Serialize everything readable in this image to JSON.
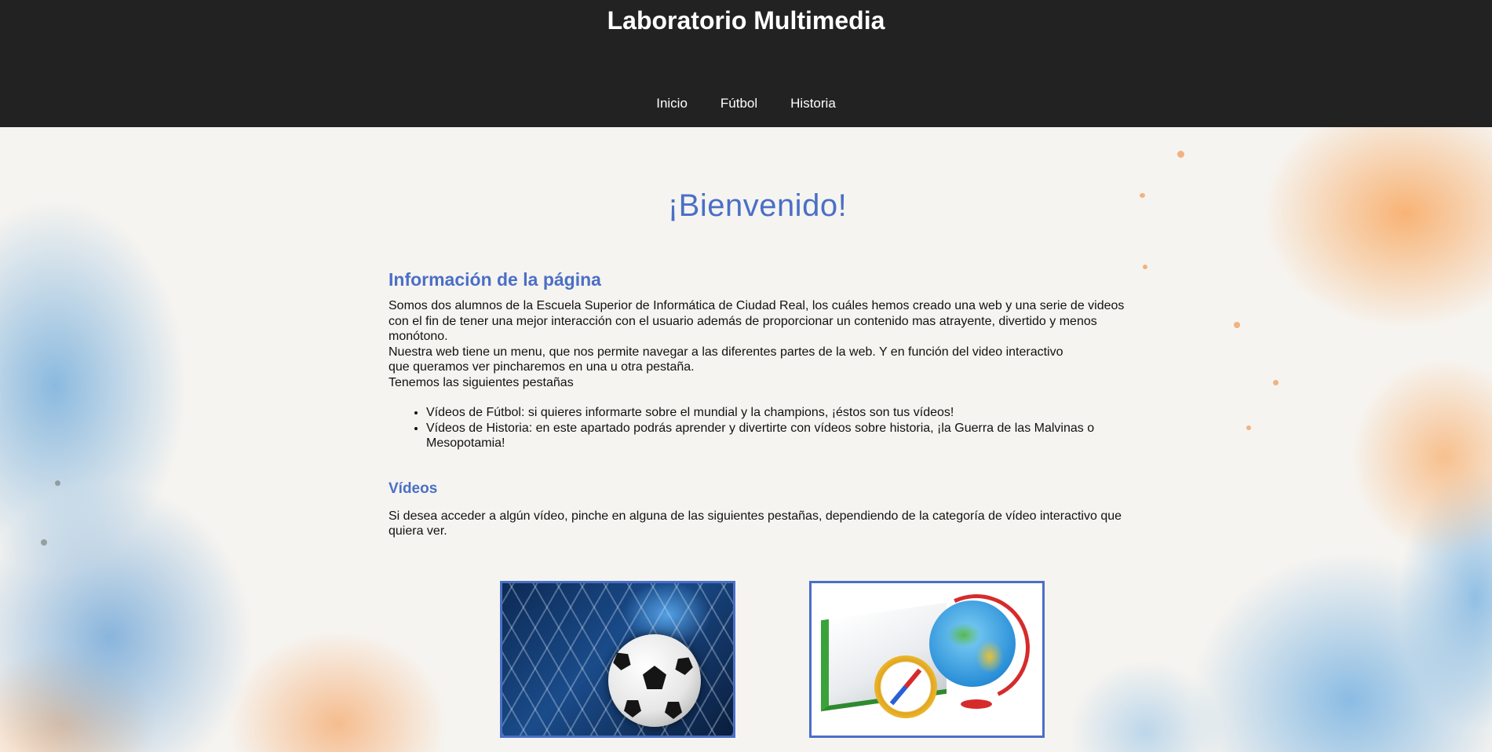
{
  "header": {
    "site_title": "Laboratorio Multimedia",
    "nav": [
      "Inicio",
      "Fútbol",
      "Historia"
    ]
  },
  "main": {
    "welcome": "¡Bienvenido!",
    "info_heading": "Información de la página",
    "info_lines": [
      "Somos dos alumnos de la Escuela Superior de Informática de Ciudad Real, los cuáles hemos creado una web y una serie de videos con el fin de tener una mejor interacción con el usuario además de proporcionar un contenido mas atrayente, divertido y menos monótono.",
      "Nuestra web tiene un menu, que nos permite navegar a las diferentes partes de la web. Y en función del video interactivo",
      "que queramos ver pincharemos en una u otra pestaña.",
      "Tenemos las siguientes pestañas"
    ],
    "tabs_list": [
      "Vídeos de Fútbol: si quieres informarte sobre el mundial y la champions, ¡éstos son tus vídeos!",
      "Vídeos de Historia: en este apartado podrás aprender y divertirte con vídeos sobre historia, ¡la Guerra de las Malvinas o Mesopotamia!"
    ],
    "videos_heading": "Vídeos",
    "videos_text": "Si desea acceder a algún vídeo, pinche en alguna de las siguientes pestañas, dependiendo de la categoría de vídeo interactivo que quiera ver."
  },
  "cards": [
    {
      "icon": "soccer-ball-in-net-image"
    },
    {
      "icon": "book-globe-compass-image"
    }
  ],
  "colors": {
    "header_bg": "#222222",
    "accent_blue": "#4a6fc7",
    "text": "#111111"
  }
}
